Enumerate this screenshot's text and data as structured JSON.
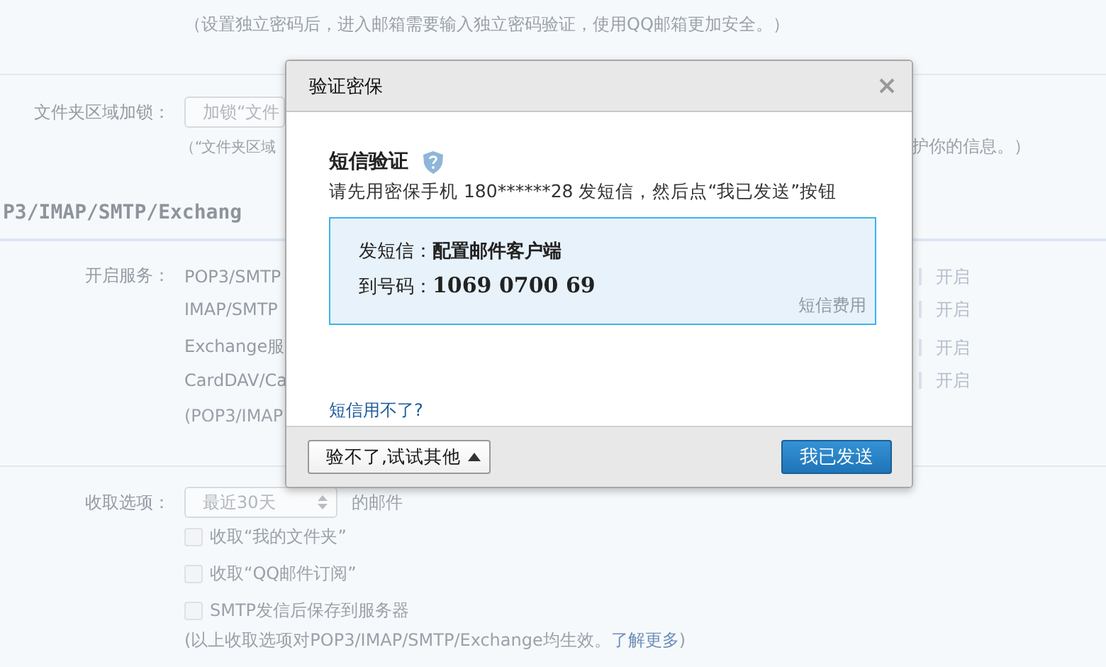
{
  "page": {
    "password_note": "（设置独立密码后，进入邮箱需要输入独立密码验证，使用QQ邮箱更加安全。）",
    "folder_lock": {
      "label": "文件夹区域加锁：",
      "select_value": "加锁“文件",
      "note_left": "（“文件夹区域",
      "note_right": "护你的信息。）"
    },
    "protocol_heading": "P3/IMAP/SMTP/Exchang",
    "services": {
      "label": "开启服务：",
      "items": [
        {
          "name": "POP3/SMTP",
          "action": "开启"
        },
        {
          "name": "IMAP/SMTP",
          "action": "开启"
        },
        {
          "name": "Exchange服",
          "action": "开启"
        },
        {
          "name": "CardDAV/Ca",
          "action": "开启"
        }
      ],
      "note": "(POP3/IMAP"
    },
    "fetch": {
      "label": "收取选项：",
      "range": "最近30天",
      "range_suffix": "的邮件",
      "options": [
        {
          "label": "收取“我的文件夹”",
          "checked": false
        },
        {
          "label": "收取“QQ邮件订阅”",
          "checked": false
        },
        {
          "label": "SMTP发信后保存到服务器",
          "checked": false
        }
      ],
      "note": "(以上收取选项对POP3/IMAP/SMTP/Exchange均生效。",
      "link": "了解更多",
      "note_end": ")"
    }
  },
  "dialog": {
    "title": "验证密保",
    "heading": "短信验证",
    "instruction": "请先用密保手机 180******28 发短信，然后点“我已发送”按钮",
    "sms_content": "发短信：**配置邮件客户端**",
    "sms_number_label": "到号码：",
    "sms_number": "1069 0700 69",
    "fee_link": "短信费用",
    "help_link": "短信用不了?",
    "other_button": "验不了,试试其他",
    "confirm_button": "我已发送"
  }
}
